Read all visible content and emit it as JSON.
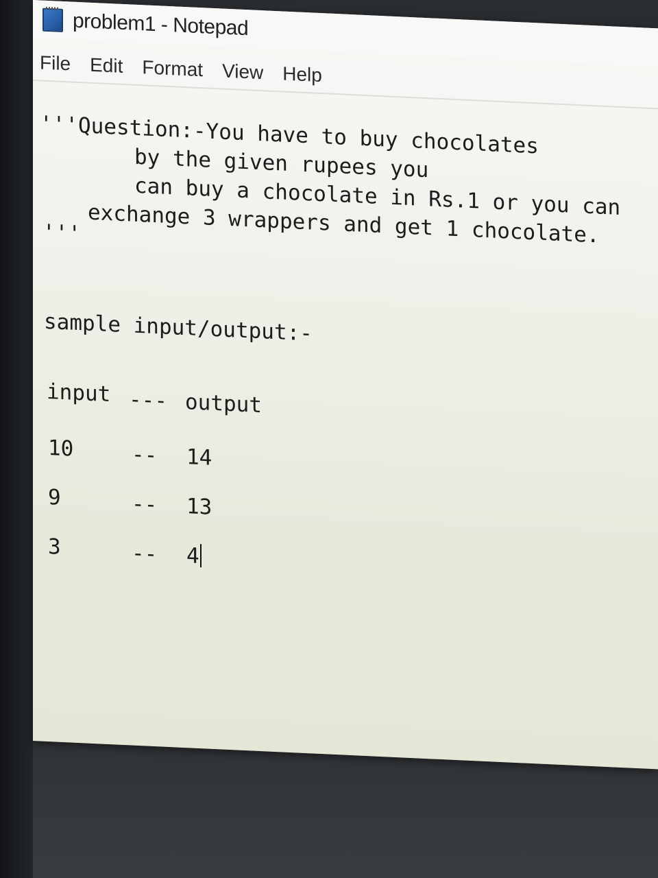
{
  "window": {
    "title": "problem1 - Notepad"
  },
  "menu": {
    "items": [
      "File",
      "Edit",
      "Format",
      "View",
      "Help"
    ]
  },
  "editor": {
    "lines": [
      "'''Question:-You have to buy chocolates",
      "by the given rupees you",
      "can buy a chocolate in Rs.1 or you can",
      "exchange 3 wrappers and get 1 chocolate.",
      "'''",
      "sample input/output:-",
      "input",
      "---",
      "output",
      "10",
      "--",
      "14",
      "9",
      "--",
      "13",
      "3",
      "--",
      "4"
    ]
  }
}
